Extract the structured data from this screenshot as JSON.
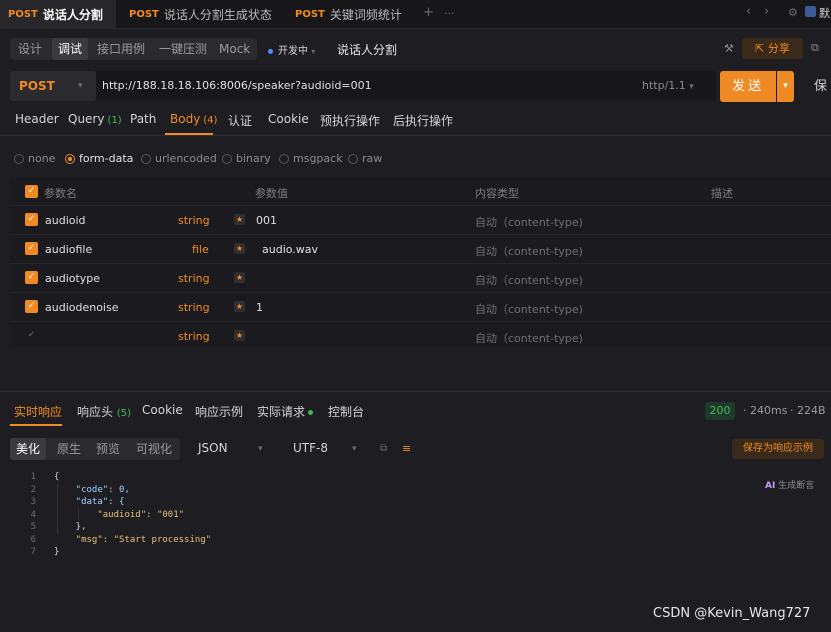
{
  "tabs": [
    {
      "method": "POST",
      "title": "说话人分割",
      "active": true
    },
    {
      "method": "POST",
      "title": "说话人分割生成状态",
      "active": false
    },
    {
      "method": "POST",
      "title": "关键词频统计",
      "active": false
    }
  ],
  "tab_controls": {
    "add": "+",
    "more": "···",
    "prev": "‹",
    "next": "›"
  },
  "modes": [
    "设计",
    "调试",
    "接口用例",
    "一键压测",
    "Mock"
  ],
  "active_mode": "调试",
  "env": {
    "label": "开发中"
  },
  "api_name": "说话人分割",
  "share_label": "分享",
  "request": {
    "method": "POST",
    "url": "http://188.18.18.106:8006/speaker?audioid=001",
    "protocol": "http/1.1",
    "send_label": "发送",
    "save_label": "保"
  },
  "param_tabs": [
    {
      "label": "Header",
      "count": ""
    },
    {
      "label": "Query",
      "count": "(1)"
    },
    {
      "label": "Path",
      "count": ""
    },
    {
      "label": "Body",
      "count": "(4)"
    },
    {
      "label": "认证",
      "count": ""
    },
    {
      "label": "Cookie",
      "count": ""
    },
    {
      "label": "预执行操作",
      "count": ""
    },
    {
      "label": "后执行操作",
      "count": ""
    }
  ],
  "body_types": [
    "none",
    "form-data",
    "urlencoded",
    "binary",
    "msgpack",
    "raw"
  ],
  "body_type_selected": "form-data",
  "table": {
    "headers": [
      "参数名",
      "参数值",
      "内容类型",
      "描述"
    ],
    "rows": [
      {
        "name": "audioid",
        "type": "string",
        "value": "001",
        "content_type": "自动（content-type)"
      },
      {
        "name": "audiofile",
        "type": "file",
        "value": "audio.wav",
        "content_type": "自动（content-type)"
      },
      {
        "name": "audiotype",
        "type": "string",
        "value": "",
        "content_type": "自动（content-type)"
      },
      {
        "name": "audiodenoise",
        "type": "string",
        "value": "1",
        "content_type": "自动（content-type)"
      },
      {
        "name": "",
        "type": "string",
        "value": "",
        "content_type": "自动（content-type)"
      }
    ]
  },
  "response_tabs": [
    {
      "label": "实时响应",
      "count": ""
    },
    {
      "label": "响应头",
      "count": "(5)"
    },
    {
      "label": "Cookie",
      "count": ""
    },
    {
      "label": "响应示例",
      "count": ""
    },
    {
      "label": "实际请求",
      "count": ""
    },
    {
      "label": "控制台",
      "count": ""
    }
  ],
  "response_meta": {
    "status": "200",
    "time": "240ms",
    "size": "224B"
  },
  "view_modes": [
    "美化",
    "原生",
    "预览",
    "可视化"
  ],
  "format": "JSON",
  "encoding": "UTF-8",
  "save_example_label": "保存为响应示例",
  "ai_label": "生成断言",
  "ai_badge": "AI",
  "code_lines": [
    "{",
    "    \"code\": 0,",
    "    \"data\": {",
    "        \"audioid\": \"001\"",
    "    },",
    "    \"msg\": \"Start processing\"",
    "}"
  ],
  "line_numbers": [
    "1",
    "2",
    "3",
    "4",
    "5",
    "6",
    "7"
  ],
  "watermark": "CSDN @Kevin_Wang727",
  "colors": {
    "accent": "#f08a24",
    "success": "#3fb950",
    "background": "#1e1e22"
  }
}
